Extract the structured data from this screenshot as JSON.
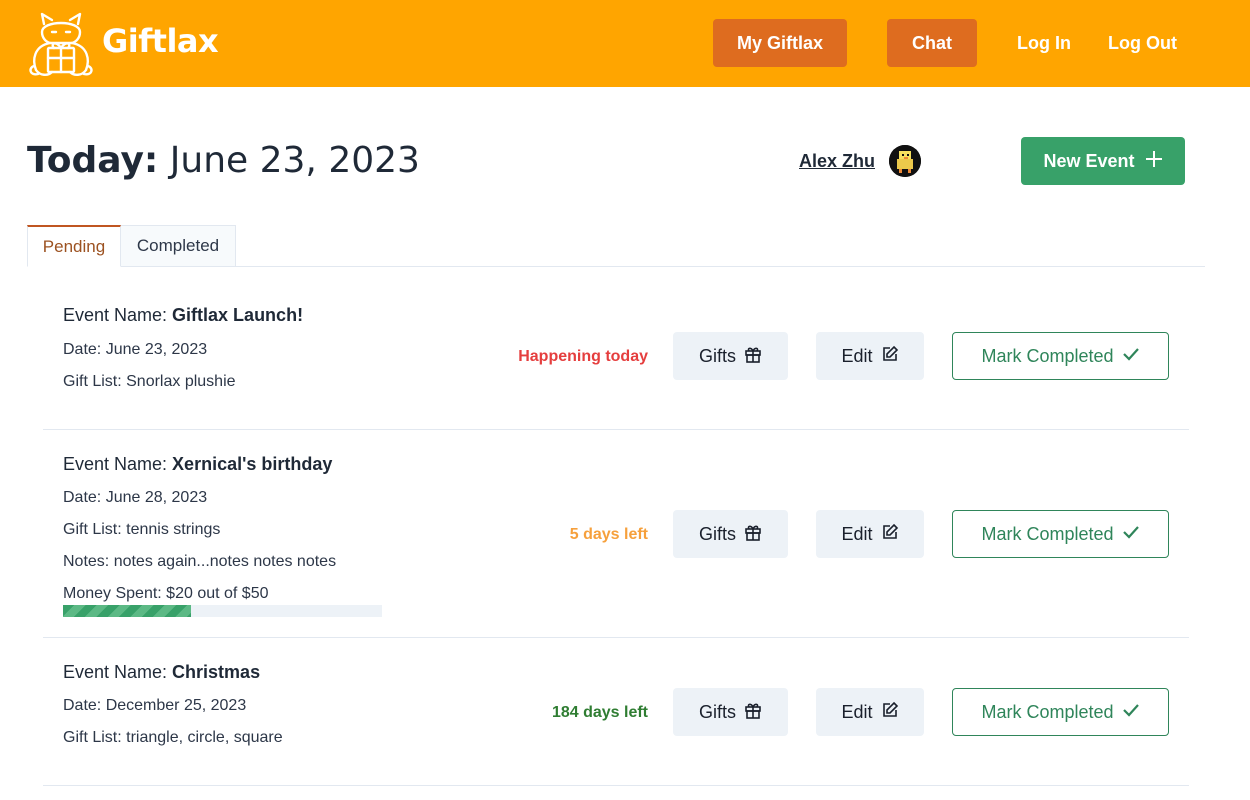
{
  "app": {
    "brand": "Giftlax"
  },
  "nav": {
    "my_giftlax": "My Giftlax",
    "chat": "Chat",
    "login": "Log In",
    "logout": "Log Out"
  },
  "header": {
    "today_label": "Today:",
    "today_date": "June 23, 2023",
    "user_name": "Alex Zhu",
    "new_event_label": "New Event"
  },
  "tabs": [
    {
      "label": "Pending",
      "active": true
    },
    {
      "label": "Completed",
      "active": false
    }
  ],
  "labels": {
    "event_name": "Event Name: ",
    "gifts": "Gifts",
    "edit": "Edit",
    "mark_completed": "Mark Completed"
  },
  "events": [
    {
      "name": "Giftlax Launch!",
      "date": "Date: June 23, 2023",
      "gift_list": "Gift List: Snorlax plushie",
      "status": "Happening today",
      "status_color": "#e53e3e"
    },
    {
      "name": "Xernical's birthday",
      "date": "Date: June 28, 2023",
      "gift_list": "Gift List: tennis strings",
      "notes": "Notes: notes again...notes notes notes",
      "money": "Money Spent: $20 out of $50",
      "money_progress": 0.4,
      "status": "5 days left",
      "status_color": "#f6a03c"
    },
    {
      "name": "Christmas",
      "date": "Date: December 25, 2023",
      "gift_list": "Gift List: triangle, circle, square",
      "status": "184 days left",
      "status_color": "#2f7d32"
    }
  ],
  "colors": {
    "header_bg": "#ffa500",
    "nav_button": "#de6c1f",
    "primary_green": "#38a169",
    "outline_green": "#2f855a"
  },
  "icons": {
    "logo": "snorlax-gift-logo",
    "gifts": "gift-icon",
    "edit": "edit-icon",
    "mark": "check-icon",
    "add": "plus-icon"
  }
}
